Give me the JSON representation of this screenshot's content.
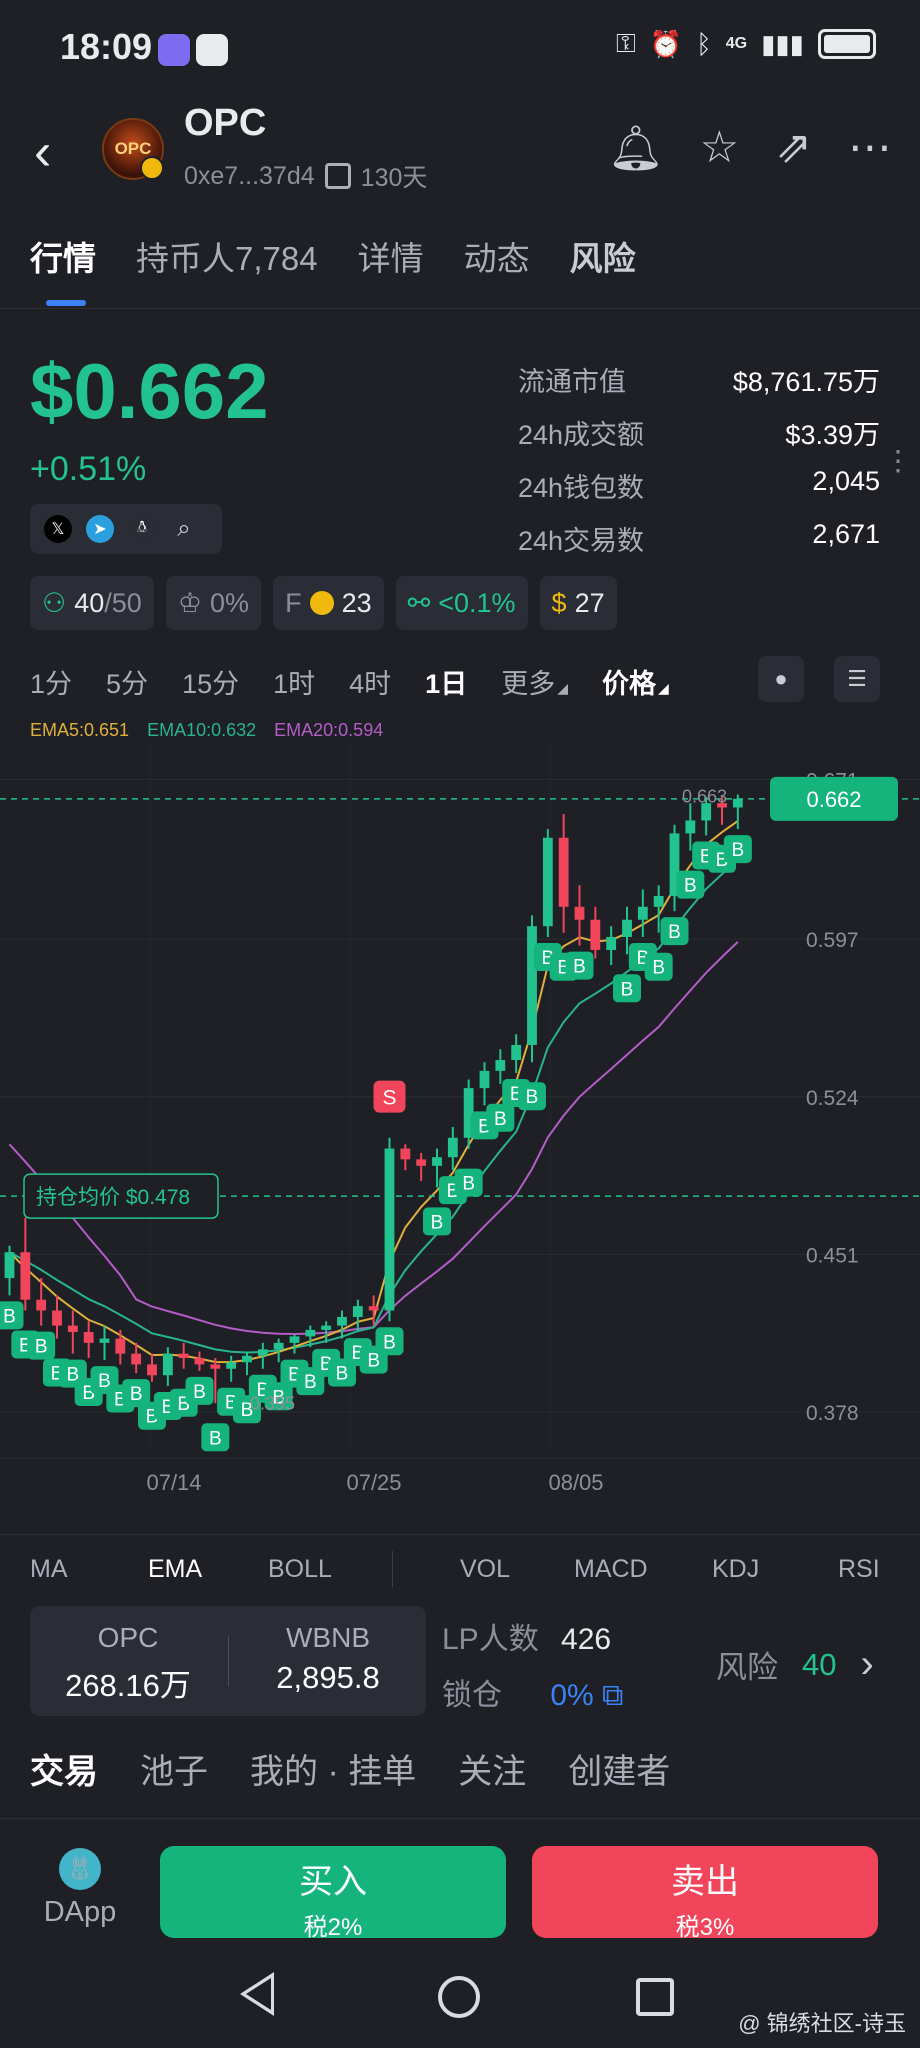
{
  "status_bar": {
    "time": "18:09",
    "network": "4G"
  },
  "header": {
    "logo_text": "OPC",
    "name": "OPC",
    "address": "0xe7...37d4",
    "age": "130天",
    "icons": [
      "bell-icon",
      "star-icon",
      "share-icon",
      "more-icon"
    ]
  },
  "tabs": [
    {
      "label": "行情",
      "active": true
    },
    {
      "label": "持币人7,784"
    },
    {
      "label": "详情"
    },
    {
      "label": "动态"
    },
    {
      "label": "风险"
    }
  ],
  "price": {
    "value": "$0.662",
    "change": "+0.51%"
  },
  "stats": [
    {
      "label": "流通市值",
      "value": "$8,761.75万"
    },
    {
      "label": "24h成交额",
      "value": "$3.39万"
    },
    {
      "label": "24h钱包数",
      "value": "2,045"
    },
    {
      "label": "24h交易数",
      "value": "2,671"
    }
  ],
  "chips": {
    "holders_a": "40",
    "holders_b": "/50",
    "top_pct": "0%",
    "f_label": "F",
    "f_value": "23",
    "dev_pct": "<0.1%",
    "bag_value": "27"
  },
  "intervals": [
    "1分",
    "5分",
    "15分",
    "1时",
    "4时",
    "1日",
    "更多",
    "价格"
  ],
  "active_interval": "1日",
  "ema_legend": {
    "ema5": "EMA5:0.651",
    "ema10": "EMA10:0.632",
    "ema20": "EMA20:0.594"
  },
  "chart_data": {
    "type": "candlestick",
    "current_price_label": "0.662",
    "high_marker": "0.663",
    "low_marker": "0.395",
    "avg_cost_label": "持仓均价 $0.478",
    "sell_marker": "S",
    "buy_marker": "B",
    "y_ticks": [
      "0.671",
      "0.597",
      "0.524",
      "0.451",
      "0.378"
    ],
    "x_ticks": [
      "07/14",
      "07/25",
      "08/05"
    ],
    "colors": {
      "up": "#22c38e",
      "down": "#f0455b",
      "ema5": "#e0b13a",
      "ema10": "#27b48e",
      "ema20": "#b45cc8"
    },
    "candles": [
      [
        0.44,
        0.455,
        0.432,
        0.452
      ],
      [
        0.452,
        0.468,
        0.425,
        0.43
      ],
      [
        0.43,
        0.44,
        0.418,
        0.425
      ],
      [
        0.425,
        0.432,
        0.412,
        0.418
      ],
      [
        0.418,
        0.425,
        0.405,
        0.415
      ],
      [
        0.415,
        0.42,
        0.403,
        0.41
      ],
      [
        0.41,
        0.418,
        0.402,
        0.412
      ],
      [
        0.412,
        0.416,
        0.4,
        0.405
      ],
      [
        0.405,
        0.41,
        0.396,
        0.4
      ],
      [
        0.4,
        0.405,
        0.392,
        0.395
      ],
      [
        0.395,
        0.408,
        0.39,
        0.405
      ],
      [
        0.405,
        0.41,
        0.398,
        0.403
      ],
      [
        0.403,
        0.406,
        0.397,
        0.4
      ],
      [
        0.4,
        0.403,
        0.382,
        0.398
      ],
      [
        0.398,
        0.404,
        0.392,
        0.401
      ],
      [
        0.401,
        0.406,
        0.395,
        0.404
      ],
      [
        0.404,
        0.41,
        0.398,
        0.407
      ],
      [
        0.407,
        0.412,
        0.401,
        0.41
      ],
      [
        0.41,
        0.414,
        0.405,
        0.413
      ],
      [
        0.413,
        0.418,
        0.408,
        0.416
      ],
      [
        0.416,
        0.42,
        0.41,
        0.418
      ],
      [
        0.418,
        0.425,
        0.412,
        0.422
      ],
      [
        0.422,
        0.43,
        0.415,
        0.427
      ],
      [
        0.427,
        0.432,
        0.418,
        0.425
      ],
      [
        0.425,
        0.505,
        0.42,
        0.5
      ],
      [
        0.5,
        0.502,
        0.49,
        0.495
      ],
      [
        0.495,
        0.498,
        0.485,
        0.492
      ],
      [
        0.492,
        0.5,
        0.482,
        0.496
      ],
      [
        0.496,
        0.51,
        0.49,
        0.505
      ],
      [
        0.505,
        0.532,
        0.5,
        0.528
      ],
      [
        0.528,
        0.54,
        0.52,
        0.536
      ],
      [
        0.536,
        0.546,
        0.53,
        0.541
      ],
      [
        0.541,
        0.553,
        0.535,
        0.548
      ],
      [
        0.548,
        0.608,
        0.54,
        0.603
      ],
      [
        0.603,
        0.648,
        0.598,
        0.644
      ],
      [
        0.644,
        0.655,
        0.6,
        0.612
      ],
      [
        0.612,
        0.622,
        0.594,
        0.606
      ],
      [
        0.606,
        0.612,
        0.588,
        0.592
      ],
      [
        0.592,
        0.603,
        0.585,
        0.598
      ],
      [
        0.598,
        0.612,
        0.59,
        0.606
      ],
      [
        0.606,
        0.62,
        0.598,
        0.612
      ],
      [
        0.612,
        0.622,
        0.6,
        0.617
      ],
      [
        0.617,
        0.65,
        0.61,
        0.646
      ],
      [
        0.646,
        0.66,
        0.638,
        0.652
      ],
      [
        0.652,
        0.663,
        0.645,
        0.66
      ],
      [
        0.66,
        0.663,
        0.65,
        0.658
      ],
      [
        0.658,
        0.664,
        0.648,
        0.662
      ]
    ]
  },
  "indicators": [
    "MA",
    "EMA",
    "BOLL",
    "VOL",
    "MACD",
    "KDJ",
    "RSI"
  ],
  "active_indicator": "EMA",
  "pool": {
    "token_a_label": "OPC",
    "token_a_value": "268.16万",
    "token_b_label": "WBNB",
    "token_b_value": "2,895.8"
  },
  "lp": {
    "label": "LP人数",
    "value": "426"
  },
  "lock": {
    "label": "锁仓",
    "value": "0%"
  },
  "risk": {
    "label": "风险",
    "value": "40"
  },
  "sub_tabs": [
    {
      "label": "交易",
      "active": true
    },
    {
      "label": "池子"
    },
    {
      "label": "我的 · 挂单"
    },
    {
      "label": "关注"
    },
    {
      "label": "创建者"
    }
  ],
  "actions": {
    "dapp": "DApp",
    "buy": "买入",
    "buy_tax": "税2%",
    "sell": "卖出",
    "sell_tax": "税3%"
  },
  "watermark": "@ 锦绣社区-诗玉"
}
